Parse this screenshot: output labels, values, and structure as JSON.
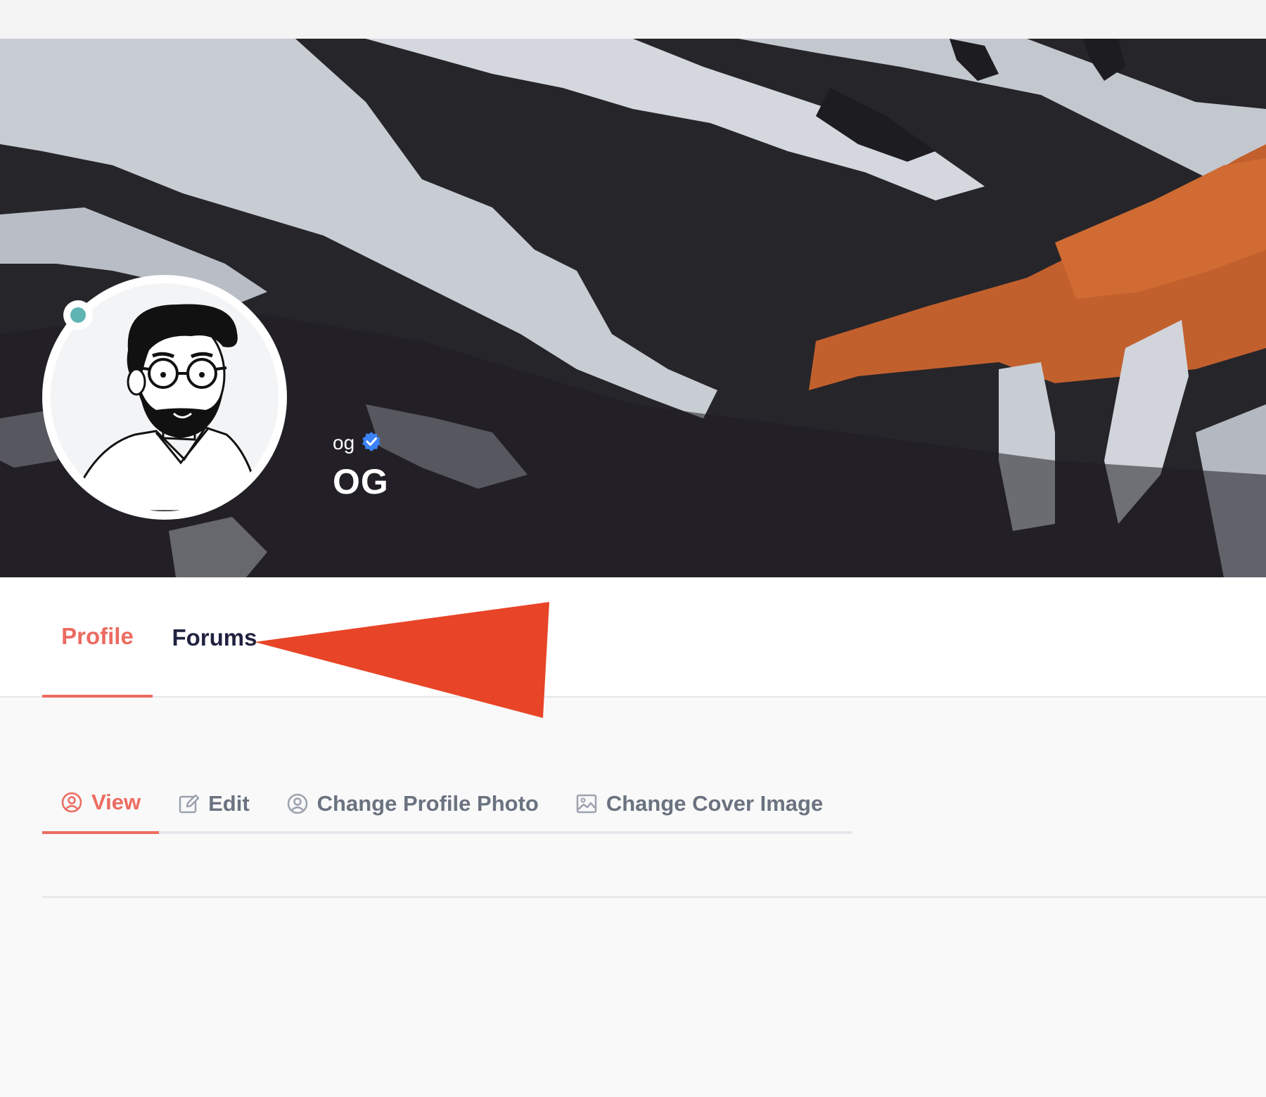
{
  "profile": {
    "username": "og",
    "display_name": "OG",
    "verified_icon": "verified-badge-icon",
    "status": "online",
    "avatar_icon": "avatar-illustration",
    "status_color": "#5eb3b3"
  },
  "main_tabs": [
    {
      "label": "Profile",
      "active": true
    },
    {
      "label": "Forums",
      "active": false
    }
  ],
  "sub_tabs": [
    {
      "label": "View",
      "icon": "user-circle-icon",
      "active": true
    },
    {
      "label": "Edit",
      "icon": "edit-icon",
      "active": false
    },
    {
      "label": "Change Profile Photo",
      "icon": "user-circle-icon",
      "active": false
    },
    {
      "label": "Change Cover Image",
      "icon": "image-icon",
      "active": false
    }
  ],
  "colors": {
    "accent": "#ec6b61",
    "annotation_arrow": "#e84427",
    "nav_text": "#1f2340",
    "muted_text": "#6b7280"
  }
}
